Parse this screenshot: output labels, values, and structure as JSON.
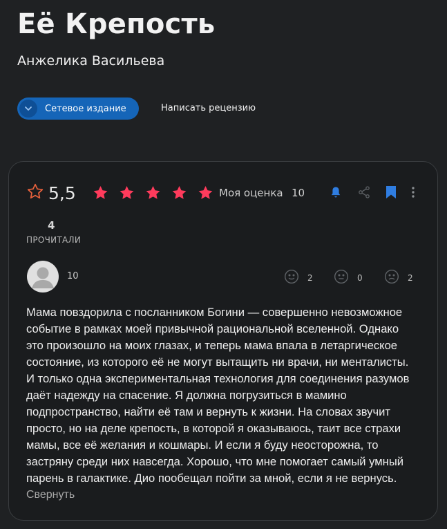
{
  "book": {
    "title": "Её Крепость",
    "author": "Анжелика Васильева"
  },
  "actions": {
    "edition_label": "Сетевое издание",
    "review_link": "Написать рецензию"
  },
  "rating": {
    "icon": "star-outline-icon",
    "value": "5,5",
    "user_stars": 5,
    "star_color": "#ff3b5c",
    "my_rating_label": "Моя оценка",
    "my_rating_value": "10"
  },
  "toolbar": {
    "icons": [
      "bell-icon",
      "share-icon",
      "bookmark-icon",
      "more-icon"
    ],
    "accent": "#2f7de1"
  },
  "stats": {
    "readers_count": "4",
    "readers_label": "ПРОЧИТАЛИ"
  },
  "review": {
    "user_score": "10",
    "reactions": [
      {
        "icon": "smile-icon",
        "count": "2"
      },
      {
        "icon": "neutral-face-icon",
        "count": "0"
      },
      {
        "icon": "sad-face-icon",
        "count": "2"
      }
    ],
    "text": "Мама повздорила с посланником Богини — совершенно невозможное\nсобытие в рамках моей привычной рациональной вселенной. Однако\nэто произошло на моих глазах, и теперь мама впала в летаргическое\nсостояние, из которого её не могут вытащить ни врачи, ни менталисты.\nИ только одна экспериментальная технология для соединения разумов\nдаёт надежду на спасение. Я должна погрузиться в мамино\nподпространство, найти её там и вернуть к жизни. На словах звучит\nпросто, но на деле крепость, в которой я оказываюсь, таит все страхи\nмамы, все её желания и кошмары. И если я буду неосторожна, то\nзастряну среди них навсегда. Хорошо, что мне помогает самый умный\nпарень в галактике. Дио пообещал пойти за мной, если я не вернусь.",
    "collapse_label": "Свернуть"
  }
}
